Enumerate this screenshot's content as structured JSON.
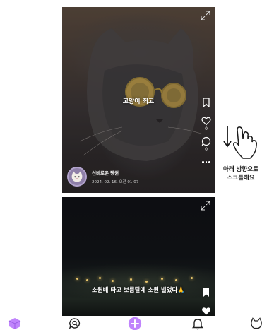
{
  "feed": [
    {
      "caption": "고양이 최고",
      "author_name": "신비로운 펭귄",
      "date": "2024. 02. 16. 오전 01:07",
      "like_count": "0",
      "comment_count": "0"
    },
    {
      "caption": "소원배 타고 보름달에 소원 빌었다🙏"
    }
  ],
  "scroll_hint": {
    "line1": "아래 방향으로",
    "line2": "스크롤해요"
  },
  "tab_bar": {
    "items": [
      "home-box-icon",
      "search-chat-icon",
      "add-icon",
      "bell-icon",
      "cat-profile-icon"
    ],
    "accent": "#c084fc"
  }
}
